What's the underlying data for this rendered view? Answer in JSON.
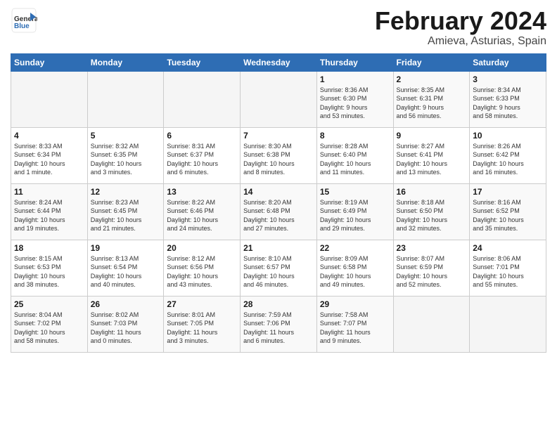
{
  "header": {
    "logo_general": "General",
    "logo_blue": "Blue",
    "month_title": "February 2024",
    "location": "Amieva, Asturias, Spain"
  },
  "days_of_week": [
    "Sunday",
    "Monday",
    "Tuesday",
    "Wednesday",
    "Thursday",
    "Friday",
    "Saturday"
  ],
  "weeks": [
    [
      {
        "day": "",
        "info": ""
      },
      {
        "day": "",
        "info": ""
      },
      {
        "day": "",
        "info": ""
      },
      {
        "day": "",
        "info": ""
      },
      {
        "day": "1",
        "info": "Sunrise: 8:36 AM\nSunset: 6:30 PM\nDaylight: 9 hours\nand 53 minutes."
      },
      {
        "day": "2",
        "info": "Sunrise: 8:35 AM\nSunset: 6:31 PM\nDaylight: 9 hours\nand 56 minutes."
      },
      {
        "day": "3",
        "info": "Sunrise: 8:34 AM\nSunset: 6:33 PM\nDaylight: 9 hours\nand 58 minutes."
      }
    ],
    [
      {
        "day": "4",
        "info": "Sunrise: 8:33 AM\nSunset: 6:34 PM\nDaylight: 10 hours\nand 1 minute."
      },
      {
        "day": "5",
        "info": "Sunrise: 8:32 AM\nSunset: 6:35 PM\nDaylight: 10 hours\nand 3 minutes."
      },
      {
        "day": "6",
        "info": "Sunrise: 8:31 AM\nSunset: 6:37 PM\nDaylight: 10 hours\nand 6 minutes."
      },
      {
        "day": "7",
        "info": "Sunrise: 8:30 AM\nSunset: 6:38 PM\nDaylight: 10 hours\nand 8 minutes."
      },
      {
        "day": "8",
        "info": "Sunrise: 8:28 AM\nSunset: 6:40 PM\nDaylight: 10 hours\nand 11 minutes."
      },
      {
        "day": "9",
        "info": "Sunrise: 8:27 AM\nSunset: 6:41 PM\nDaylight: 10 hours\nand 13 minutes."
      },
      {
        "day": "10",
        "info": "Sunrise: 8:26 AM\nSunset: 6:42 PM\nDaylight: 10 hours\nand 16 minutes."
      }
    ],
    [
      {
        "day": "11",
        "info": "Sunrise: 8:24 AM\nSunset: 6:44 PM\nDaylight: 10 hours\nand 19 minutes."
      },
      {
        "day": "12",
        "info": "Sunrise: 8:23 AM\nSunset: 6:45 PM\nDaylight: 10 hours\nand 21 minutes."
      },
      {
        "day": "13",
        "info": "Sunrise: 8:22 AM\nSunset: 6:46 PM\nDaylight: 10 hours\nand 24 minutes."
      },
      {
        "day": "14",
        "info": "Sunrise: 8:20 AM\nSunset: 6:48 PM\nDaylight: 10 hours\nand 27 minutes."
      },
      {
        "day": "15",
        "info": "Sunrise: 8:19 AM\nSunset: 6:49 PM\nDaylight: 10 hours\nand 29 minutes."
      },
      {
        "day": "16",
        "info": "Sunrise: 8:18 AM\nSunset: 6:50 PM\nDaylight: 10 hours\nand 32 minutes."
      },
      {
        "day": "17",
        "info": "Sunrise: 8:16 AM\nSunset: 6:52 PM\nDaylight: 10 hours\nand 35 minutes."
      }
    ],
    [
      {
        "day": "18",
        "info": "Sunrise: 8:15 AM\nSunset: 6:53 PM\nDaylight: 10 hours\nand 38 minutes."
      },
      {
        "day": "19",
        "info": "Sunrise: 8:13 AM\nSunset: 6:54 PM\nDaylight: 10 hours\nand 40 minutes."
      },
      {
        "day": "20",
        "info": "Sunrise: 8:12 AM\nSunset: 6:56 PM\nDaylight: 10 hours\nand 43 minutes."
      },
      {
        "day": "21",
        "info": "Sunrise: 8:10 AM\nSunset: 6:57 PM\nDaylight: 10 hours\nand 46 minutes."
      },
      {
        "day": "22",
        "info": "Sunrise: 8:09 AM\nSunset: 6:58 PM\nDaylight: 10 hours\nand 49 minutes."
      },
      {
        "day": "23",
        "info": "Sunrise: 8:07 AM\nSunset: 6:59 PM\nDaylight: 10 hours\nand 52 minutes."
      },
      {
        "day": "24",
        "info": "Sunrise: 8:06 AM\nSunset: 7:01 PM\nDaylight: 10 hours\nand 55 minutes."
      }
    ],
    [
      {
        "day": "25",
        "info": "Sunrise: 8:04 AM\nSunset: 7:02 PM\nDaylight: 10 hours\nand 58 minutes."
      },
      {
        "day": "26",
        "info": "Sunrise: 8:02 AM\nSunset: 7:03 PM\nDaylight: 11 hours\nand 0 minutes."
      },
      {
        "day": "27",
        "info": "Sunrise: 8:01 AM\nSunset: 7:05 PM\nDaylight: 11 hours\nand 3 minutes."
      },
      {
        "day": "28",
        "info": "Sunrise: 7:59 AM\nSunset: 7:06 PM\nDaylight: 11 hours\nand 6 minutes."
      },
      {
        "day": "29",
        "info": "Sunrise: 7:58 AM\nSunset: 7:07 PM\nDaylight: 11 hours\nand 9 minutes."
      },
      {
        "day": "",
        "info": ""
      },
      {
        "day": "",
        "info": ""
      }
    ]
  ]
}
